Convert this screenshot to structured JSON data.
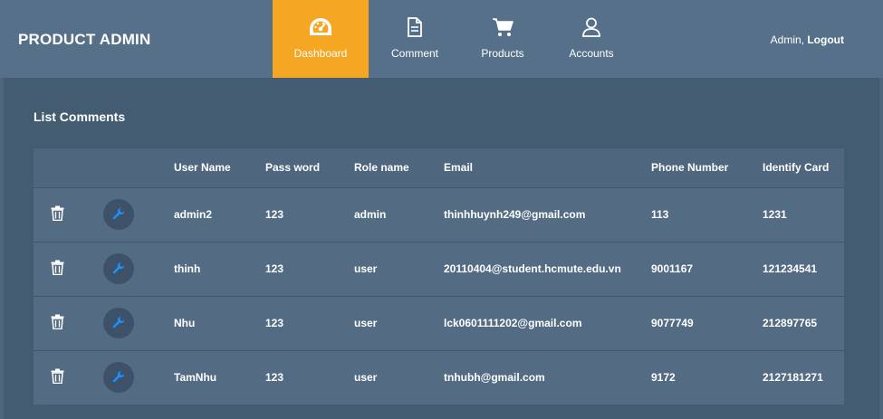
{
  "brand": "PRODUCT ADMIN",
  "nav": [
    {
      "label": "Dashboard",
      "icon": "speedometer-icon",
      "active": true
    },
    {
      "label": "Comment",
      "icon": "document-icon"
    },
    {
      "label": "Products",
      "icon": "cart-icon"
    },
    {
      "label": "Accounts",
      "icon": "user-icon"
    }
  ],
  "user": {
    "name": "Admin,",
    "logout": "Logout"
  },
  "panel": {
    "title": "List Comments"
  },
  "table": {
    "headers": [
      "User Name",
      "Pass word",
      "Role name",
      "Email",
      "Phone Number",
      "Identify Card"
    ],
    "rows": [
      {
        "user": "admin2",
        "pass": "123",
        "role": "admin",
        "email": "thinhhuynh249@gmail.com",
        "phone": "113",
        "card": "1231"
      },
      {
        "user": "thinh",
        "pass": "123",
        "role": "user",
        "email": "20110404@student.hcmute.edu.vn",
        "phone": "9001167",
        "card": "121234541"
      },
      {
        "user": "Nhu",
        "pass": "123",
        "role": "user",
        "email": "lck0601111202@gmail.com",
        "phone": "9077749",
        "card": "212897765"
      },
      {
        "user": "TamNhu",
        "pass": "123",
        "role": "user",
        "email": "tnhubh@gmail.com",
        "phone": "9172",
        "card": "2127181271"
      }
    ]
  },
  "colors": {
    "accent": "#f5a623",
    "edit_icon": "#1e90ff"
  }
}
